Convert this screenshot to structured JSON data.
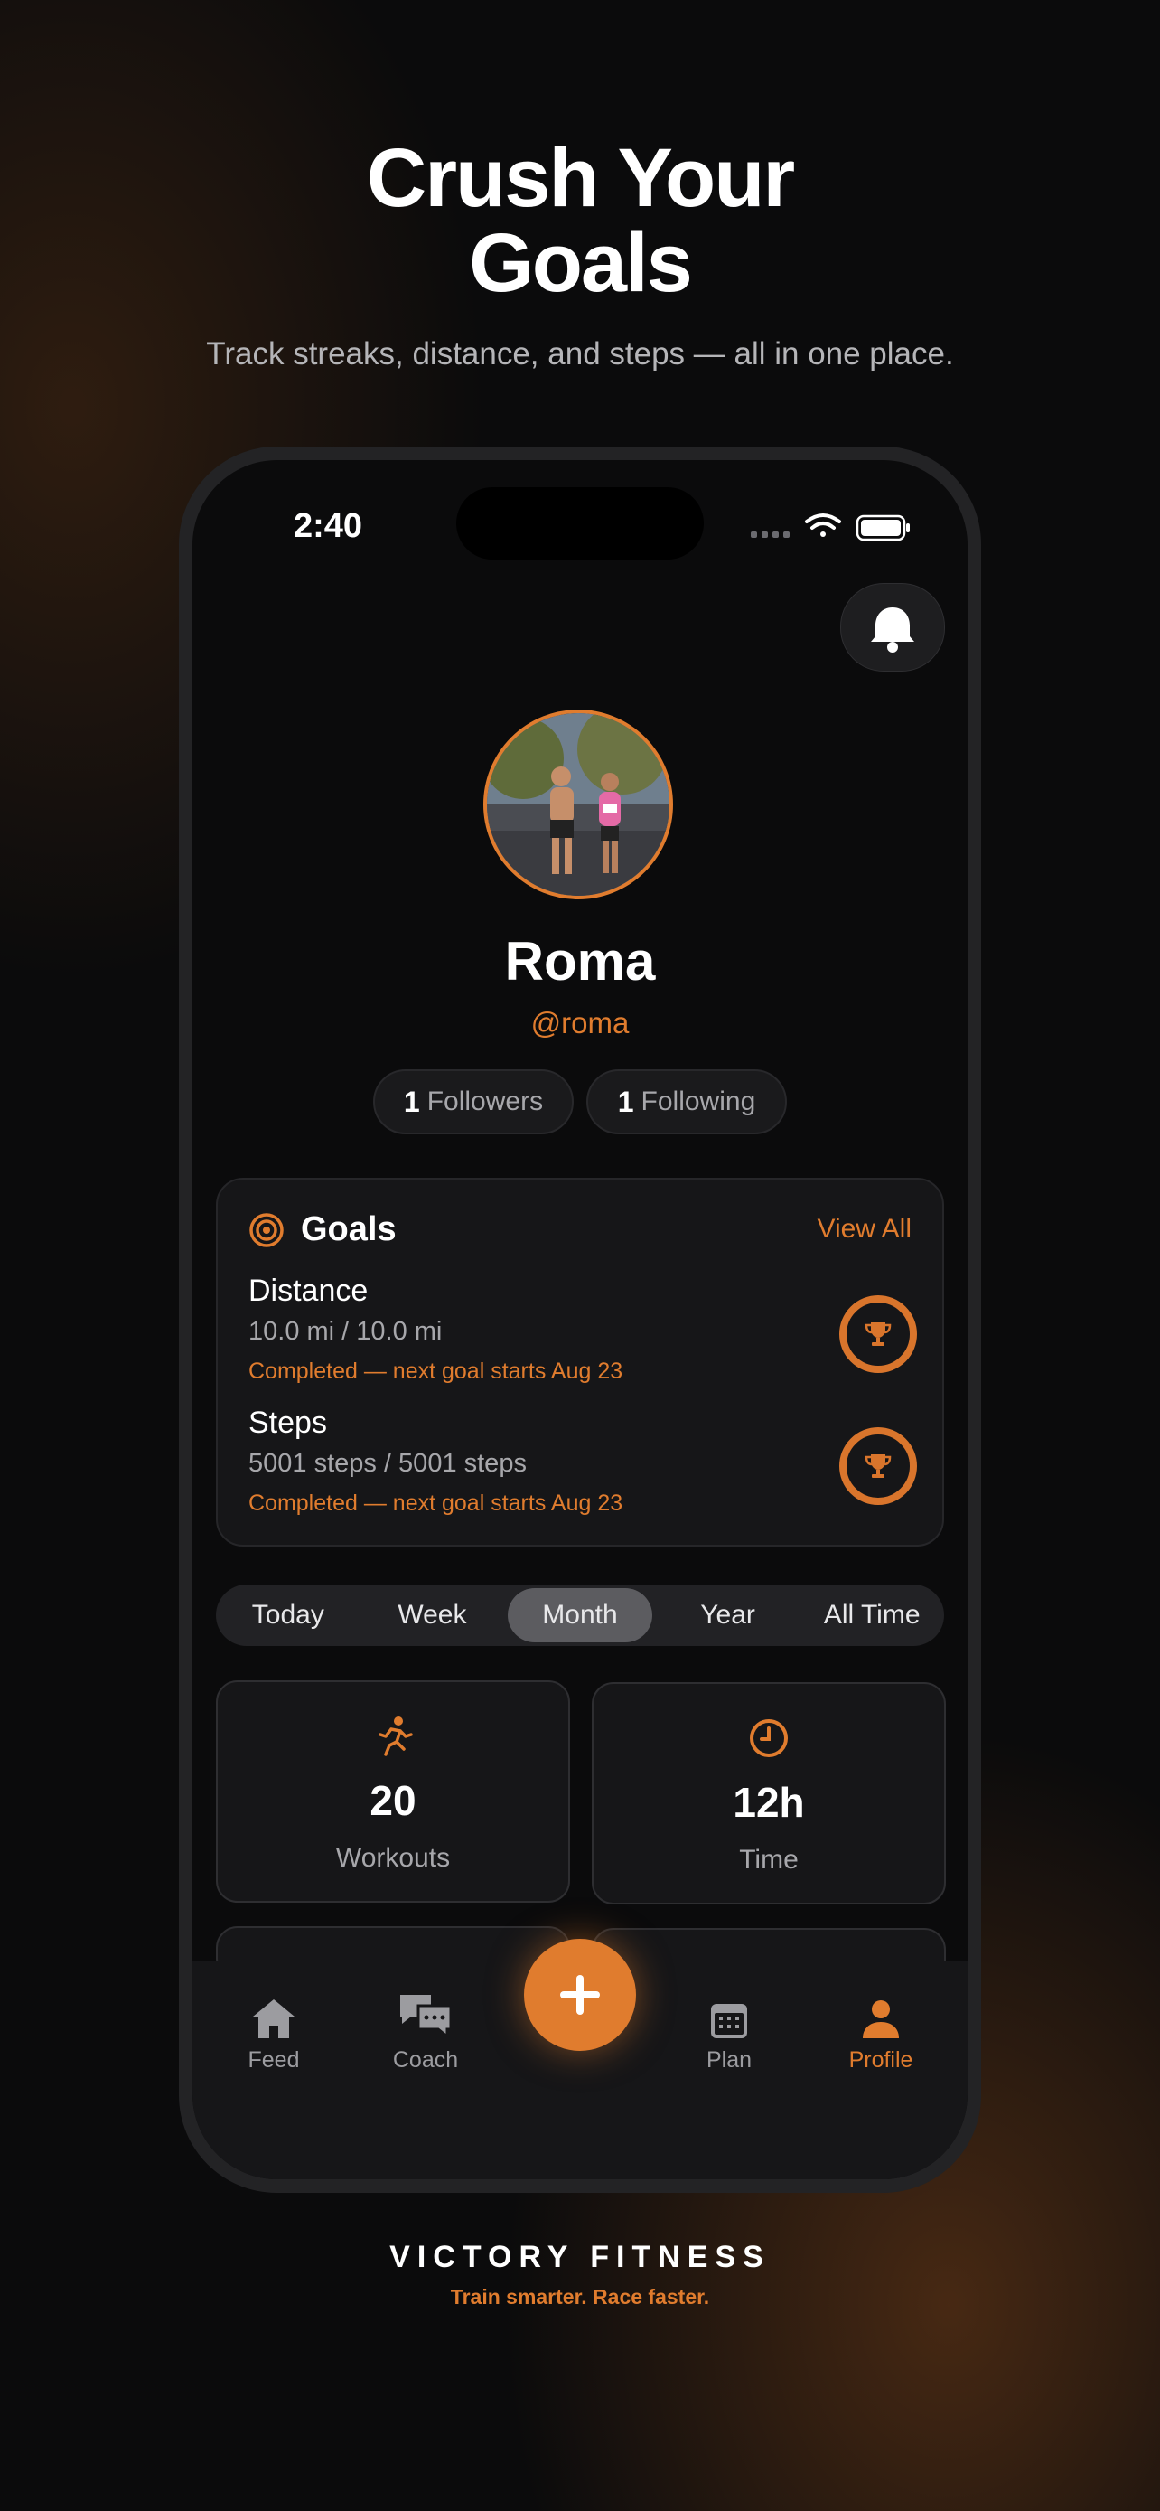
{
  "hero": {
    "headline_line1": "Crush Your",
    "headline_line2": "Goals",
    "subtitle": "Track streaks, distance, and steps — all in one place."
  },
  "status_bar": {
    "time": "2:40"
  },
  "profile": {
    "name": "Roma",
    "handle": "@roma",
    "followers_count": "1",
    "followers_label": "Followers",
    "following_count": "1",
    "following_label": "Following"
  },
  "goals": {
    "title": "Goals",
    "view_all": "View All",
    "items": [
      {
        "name": "Distance",
        "progress": "10.0 mi / 10.0 mi",
        "status": "Completed — next goal starts Aug 23"
      },
      {
        "name": "Steps",
        "progress": "5001 steps / 5001 steps",
        "status": "Completed — next goal starts Aug 23"
      }
    ]
  },
  "period_tabs": [
    "Today",
    "Week",
    "Month",
    "Year",
    "All Time"
  ],
  "selected_period": "Month",
  "stats": [
    {
      "value": "20",
      "label": "Workouts",
      "icon": "running-icon"
    },
    {
      "value": "12h",
      "label": "Time",
      "icon": "clock-icon"
    }
  ],
  "tabbar": {
    "items": [
      {
        "label": "Feed",
        "icon": "home-icon"
      },
      {
        "label": "Coach",
        "icon": "chat-bubbles-icon"
      },
      {
        "label": "Plan",
        "icon": "calendar-icon"
      },
      {
        "label": "Profile",
        "icon": "person-icon"
      }
    ],
    "active": "Profile",
    "fab_icon": "plus-icon"
  },
  "footer": {
    "brand": "VICTORY FITNESS",
    "tagline": "Train smarter. Race faster."
  },
  "colors": {
    "accent": "#e07c2e",
    "background": "#0b0b0c",
    "card": "#161618"
  }
}
